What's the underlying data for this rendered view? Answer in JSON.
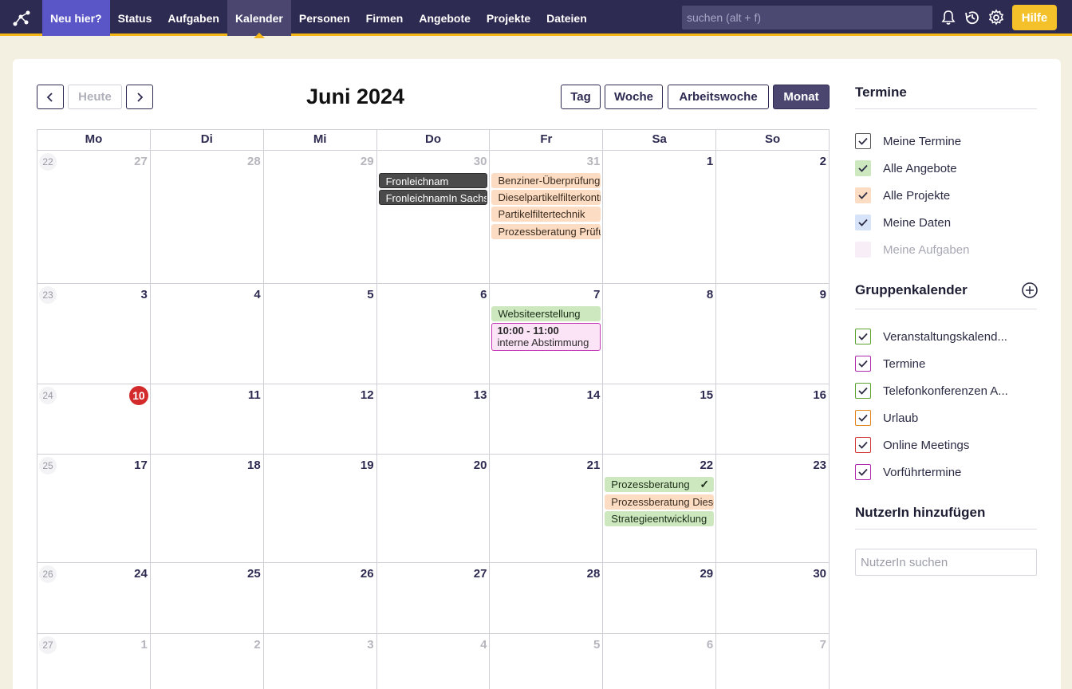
{
  "nav": {
    "items": [
      {
        "label": "Neu hier?"
      },
      {
        "label": "Status"
      },
      {
        "label": "Aufgaben"
      },
      {
        "label": "Kalender"
      },
      {
        "label": "Personen"
      },
      {
        "label": "Firmen"
      },
      {
        "label": "Angebote"
      },
      {
        "label": "Projekte"
      },
      {
        "label": "Dateien"
      }
    ],
    "search_placeholder": "suchen (alt + f)",
    "help_label": "Hilfe",
    "icons": [
      "logo-icon",
      "bell-icon",
      "history-icon",
      "gear-icon"
    ]
  },
  "calendar": {
    "title": "Juni 2024",
    "today_label": "Heute",
    "views": [
      "Tag",
      "Woche",
      "Arbeitswoche",
      "Monat"
    ],
    "active_view": "Monat",
    "weekdays": [
      "Mo",
      "Di",
      "Mi",
      "Do",
      "Fr",
      "Sa",
      "So"
    ],
    "weeks": [
      {
        "kw": "22",
        "days": [
          "27",
          "28",
          "29",
          "30",
          "31",
          "1",
          "2"
        ]
      },
      {
        "kw": "23",
        "days": [
          "3",
          "4",
          "5",
          "6",
          "7",
          "8",
          "9"
        ]
      },
      {
        "kw": "24",
        "days": [
          "10",
          "11",
          "12",
          "13",
          "14",
          "15",
          "16"
        ]
      },
      {
        "kw": "25",
        "days": [
          "17",
          "18",
          "19",
          "20",
          "21",
          "22",
          "23"
        ]
      },
      {
        "kw": "26",
        "days": [
          "24",
          "25",
          "26",
          "27",
          "28",
          "29",
          "30"
        ]
      },
      {
        "kw": "27",
        "days": [
          "1",
          "2",
          "3",
          "4",
          "5",
          "6",
          "7"
        ]
      }
    ],
    "today_day": "10",
    "events": {
      "do30": [
        "Fronleichnam",
        "FronleichnamIn Sachsen"
      ],
      "fr31": [
        "Benziner-Überprüfung",
        "Dieselpartikelfilterkontrolle",
        "Partikelfiltertechnik",
        "Prozessberatung Prüfung"
      ],
      "fr7_green": "Websiteerstellung",
      "fr7_meeting": {
        "time": "10:00 - 11:00",
        "title": "interne Abstimmung"
      },
      "sa22": [
        "Prozessberatung",
        "Prozessberatung Diesel",
        "Strategieentwicklung"
      ]
    },
    "colors": {
      "peach": "#fcdcc3",
      "green": "#cde8bf",
      "dark": "#4a4a4a",
      "pink_border": "#c43bb8",
      "today": "#d32b2b"
    }
  },
  "sidebar": {
    "termine_heading": "Termine",
    "termine_items": [
      {
        "label": "Meine Termine",
        "checked": true,
        "color": "#ffffff"
      },
      {
        "label": "Alle Angebote",
        "checked": true,
        "color": "#cde8bf"
      },
      {
        "label": "Alle Projekte",
        "checked": true,
        "color": "#fcdcc3"
      },
      {
        "label": "Meine Daten",
        "checked": true,
        "color": "#d6e3f8"
      },
      {
        "label": "Meine Aufgaben",
        "checked": false,
        "color": "#f8eef8"
      }
    ],
    "group_heading": "Gruppenkalender",
    "group_items": [
      {
        "label": "Veranstaltungskalend...",
        "border": "#5aa32e"
      },
      {
        "label": "Termine",
        "border": "#b02ab0"
      },
      {
        "label": "Telefonkonferenzen A...",
        "border": "#5aa32e"
      },
      {
        "label": "Urlaub",
        "border": "#e2841b"
      },
      {
        "label": "Online Meetings",
        "border": "#d23a3a"
      },
      {
        "label": "Vorführtermine",
        "border": "#b02ab0"
      }
    ],
    "add_user_heading": "NutzerIn hinzufügen",
    "user_search_placeholder": "NutzerIn suchen"
  }
}
